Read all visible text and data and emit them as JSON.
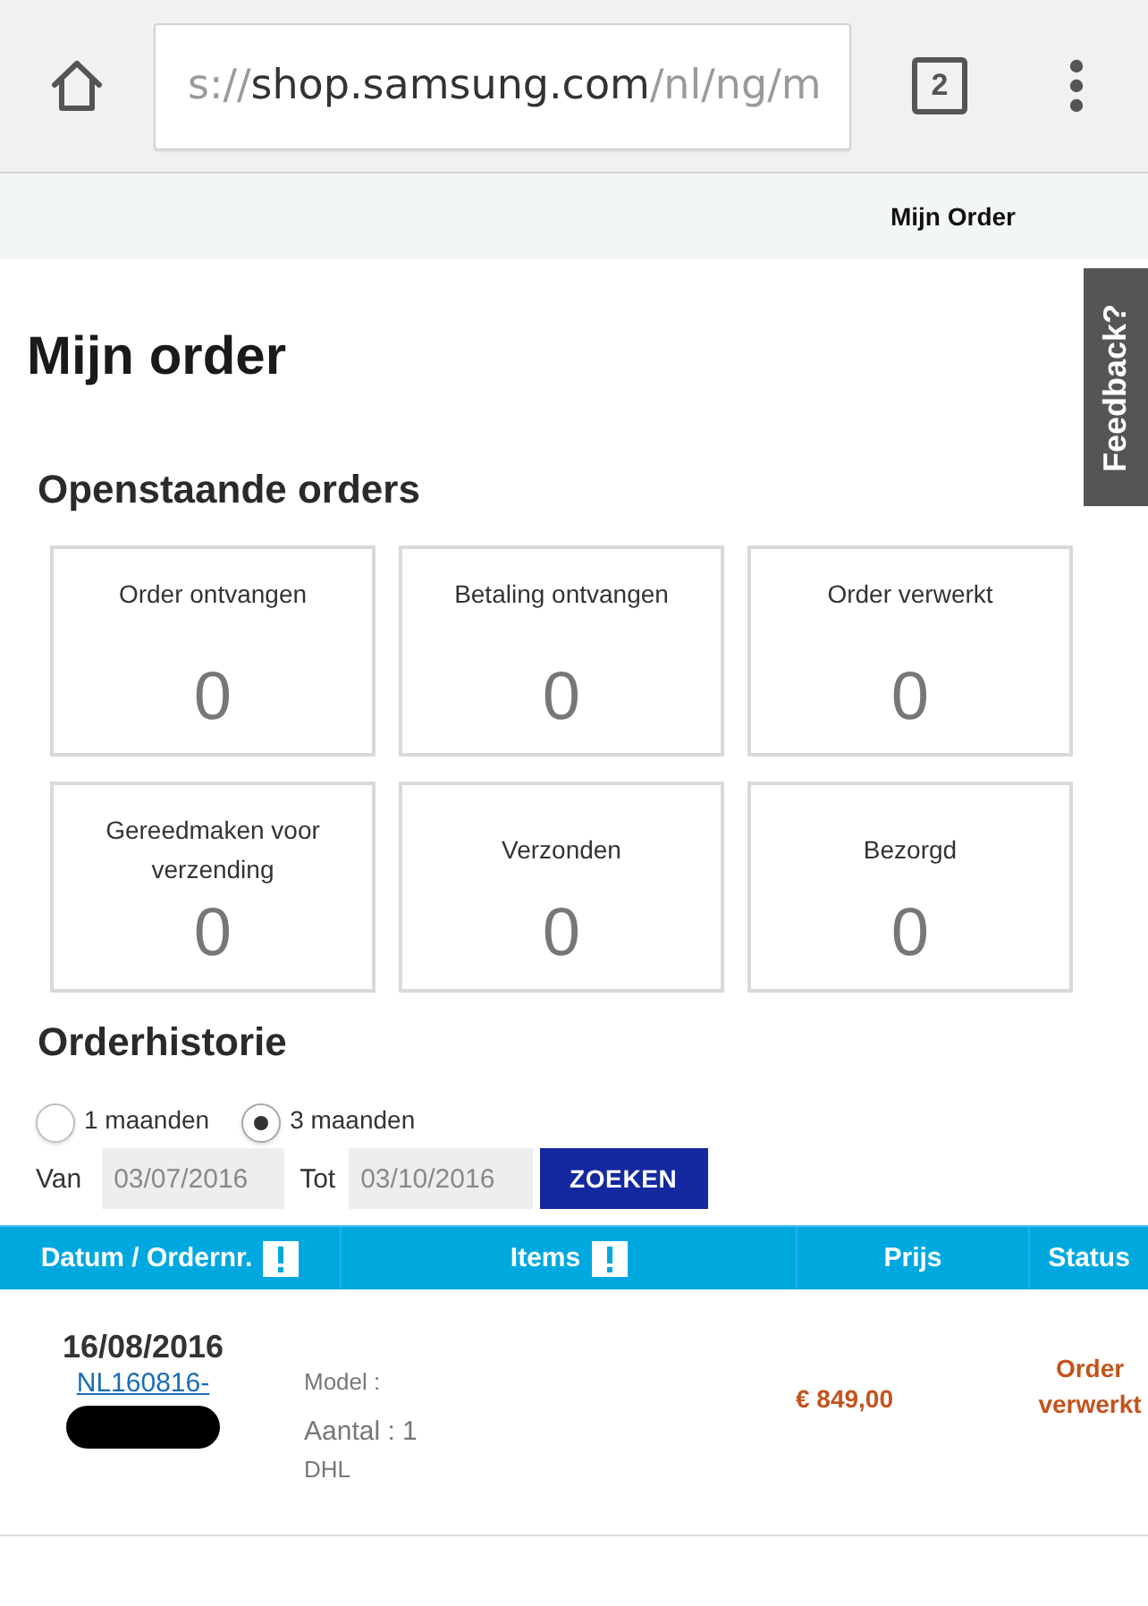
{
  "browser": {
    "url": {
      "scheme": "s://",
      "host": "shop.samsung.com",
      "path": "/nl/ng/m"
    },
    "tab_count": "2"
  },
  "breadcrumb": "Mijn Order",
  "feedback_tab": "Feedback?",
  "page_title": "Mijn order",
  "open_orders": {
    "heading": "Openstaande orders",
    "cards": [
      {
        "label": "Order ontvangen",
        "count": "0"
      },
      {
        "label": "Betaling ontvangen",
        "count": "0"
      },
      {
        "label": "Order verwerkt",
        "count": "0"
      },
      {
        "label": "Gereedmaken voor verzending",
        "count": "0"
      },
      {
        "label": "Verzonden",
        "count": "0"
      },
      {
        "label": "Bezorgd",
        "count": "0"
      }
    ]
  },
  "order_history": {
    "heading": "Orderhistorie",
    "periods": [
      {
        "label": "1 maanden",
        "selected": false
      },
      {
        "label": "3 maanden",
        "selected": true
      }
    ],
    "from_label": "Van",
    "from_value": "03/07/2016",
    "to_label": "Tot",
    "to_value": "03/10/2016",
    "search_button": "ZOEKEN"
  },
  "table": {
    "columns": [
      {
        "label": "Datum / Ordernr.",
        "info": true
      },
      {
        "label": "Items",
        "info": true
      },
      {
        "label": "Prijs",
        "info": false
      },
      {
        "label": "Status",
        "info": false
      }
    ],
    "rows": [
      {
        "date": "16/08/2016",
        "order_number": "NL160816-",
        "redacted": true,
        "model_label": "Model :",
        "quantity": "Aantal : 1",
        "carrier": "DHL",
        "price": "€ 849,00",
        "status": "Order verwerkt"
      }
    ]
  }
}
